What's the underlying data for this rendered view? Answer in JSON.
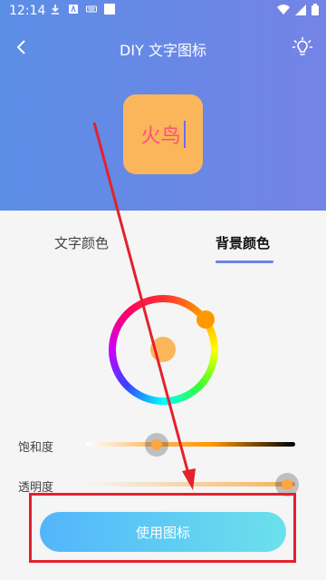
{
  "status_bar": {
    "time": "12:14",
    "left_icons": [
      "download-icon",
      "a-box-icon",
      "keyboard-icon",
      "square-icon"
    ],
    "right_icons": [
      "wifi-icon",
      "signal-icon",
      "battery-icon"
    ]
  },
  "header": {
    "title": "DIY 文字图标",
    "back_icon": "back-arrow-icon",
    "right_icon": "lightbulb-icon"
  },
  "preview": {
    "text": "火鸟",
    "bg_color": "#fbb55b",
    "text_color": "#ff4f7a"
  },
  "tabs": [
    {
      "label": "文字颜色",
      "active": false
    },
    {
      "label": "背景颜色",
      "active": true
    }
  ],
  "color_picker": {
    "selected_color": "#fbb55b",
    "handle_color": "#ff9800"
  },
  "sliders": {
    "saturation_label": "饱和度",
    "saturation_value": 0.35,
    "alpha_label": "透明度",
    "alpha_value": 0.96
  },
  "use_button_label": "使用图标",
  "colors": {
    "header_start": "#5b8ee6",
    "header_end": "#7483e6",
    "button_start": "#52b5fb",
    "button_end": "#6be1ec",
    "annotation": "#e4212c"
  }
}
